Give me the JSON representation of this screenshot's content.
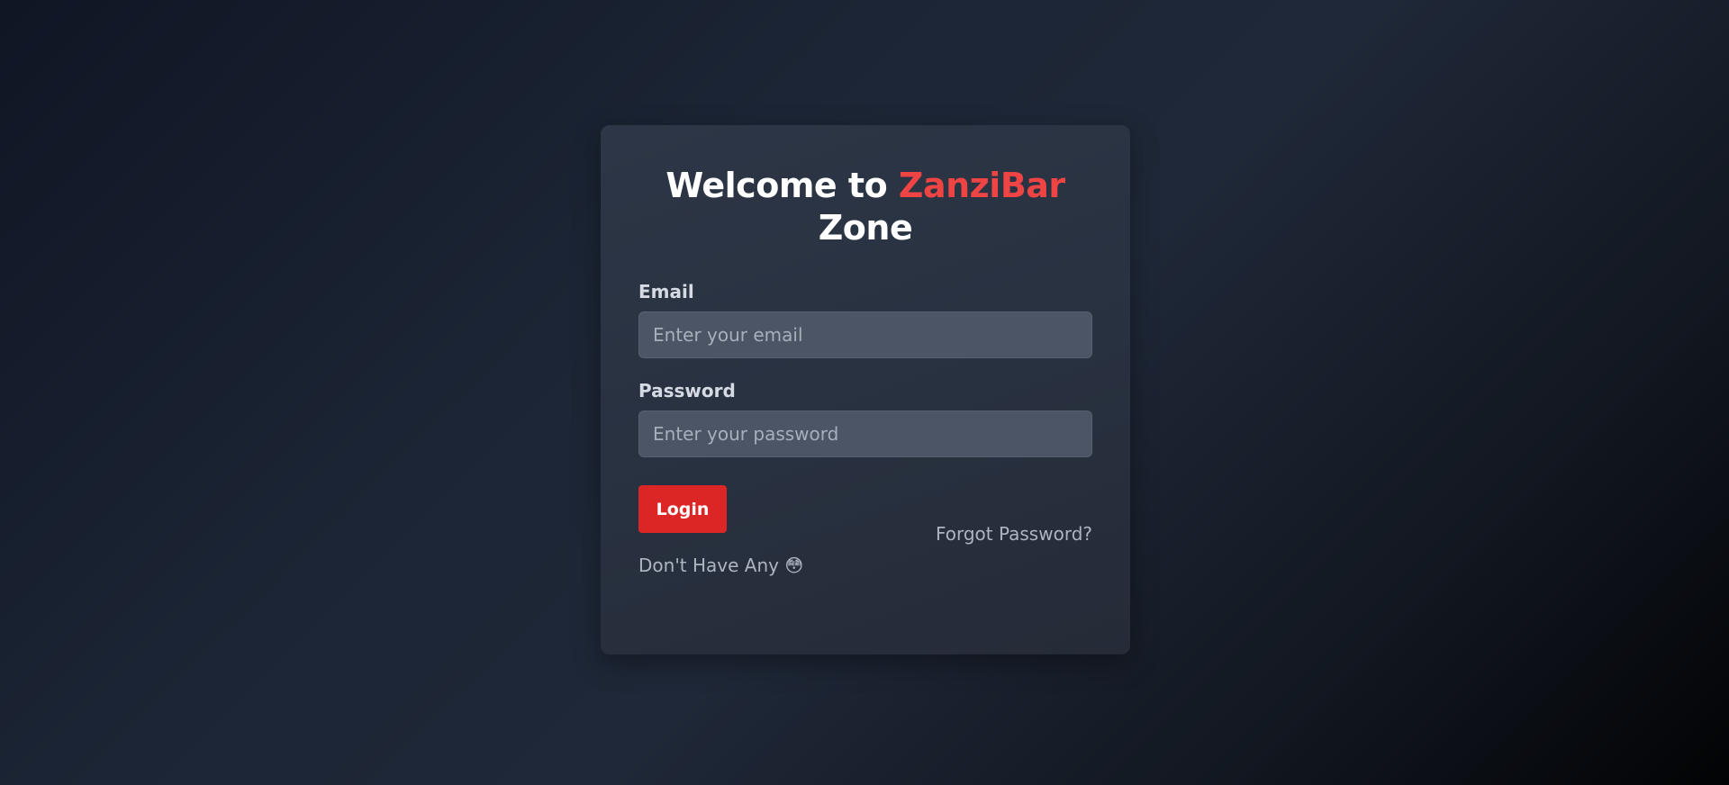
{
  "login_card": {
    "title_part1": "Welcome to ",
    "title_brand": "ZanziBar",
    "title_part2": " Zone",
    "email": {
      "label": "Email",
      "placeholder": "Enter your email",
      "value": ""
    },
    "password": {
      "label": "Password",
      "placeholder": "Enter your password",
      "value": ""
    },
    "login_button": "Login",
    "forgot_password": "Forgot Password?",
    "signup_text": "Don't Have Any",
    "signup_emoji": "😳"
  },
  "colors": {
    "accent": "#ef4444",
    "button": "#dc2626",
    "card_background": "#2b3444",
    "input_background": "#4b5565"
  },
  "icons": {
    "signup_emoji": "flushed-face-emoji"
  }
}
